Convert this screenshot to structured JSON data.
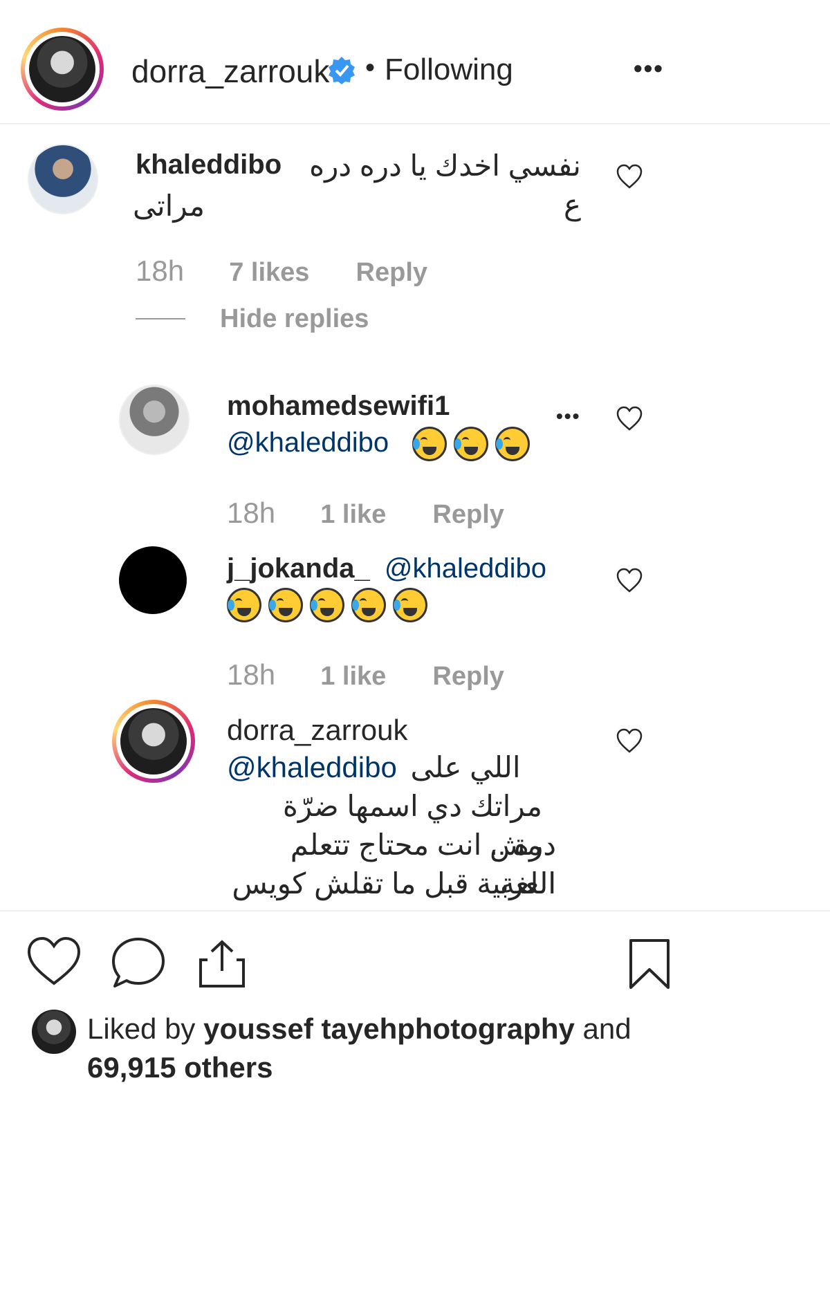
{
  "header": {
    "username": "dorra_zarrouk",
    "separator": "•",
    "follow_status": "Following",
    "more_label": "•••"
  },
  "comments": [
    {
      "username": "khaleddibo",
      "text_line1": "نفسي اخدك يا دره دره ع",
      "text_line2": "مراتى",
      "time": "18h",
      "likes": "7 likes",
      "reply": "Reply",
      "hide_replies": "Hide replies"
    }
  ],
  "replies": [
    {
      "username": "mohamedsewifi1",
      "mention": "@khaleddibo",
      "emoji_count": 3,
      "time": "18h",
      "likes": "1 like",
      "reply": "Reply",
      "more_label": "•••"
    },
    {
      "username": "j_jokanda_",
      "mention": "@khaleddibo",
      "emoji_count": 5,
      "time": "18h",
      "likes": "1 like",
      "reply": "Reply"
    },
    {
      "username": "dorra_zarrouk",
      "mention": "@khaleddibo",
      "text_line1": "اللي على",
      "text_line2": "مراتك دي اسمها ضرّة مش",
      "text_line3": "درة .. انت محتاج تتعلم اللغة",
      "text_line4": "العربية قبل ما تقلش كويس"
    }
  ],
  "footer": {
    "liked_by_prefix": "Liked by",
    "liked_by_user": "youssefta yehphotography",
    "liked_by_user_exact": "youssef tayehphotography",
    "and": "and",
    "others": "69,915 others"
  },
  "colors": {
    "verified": "#3897f0",
    "mention": "#003569",
    "muted": "#999999"
  }
}
